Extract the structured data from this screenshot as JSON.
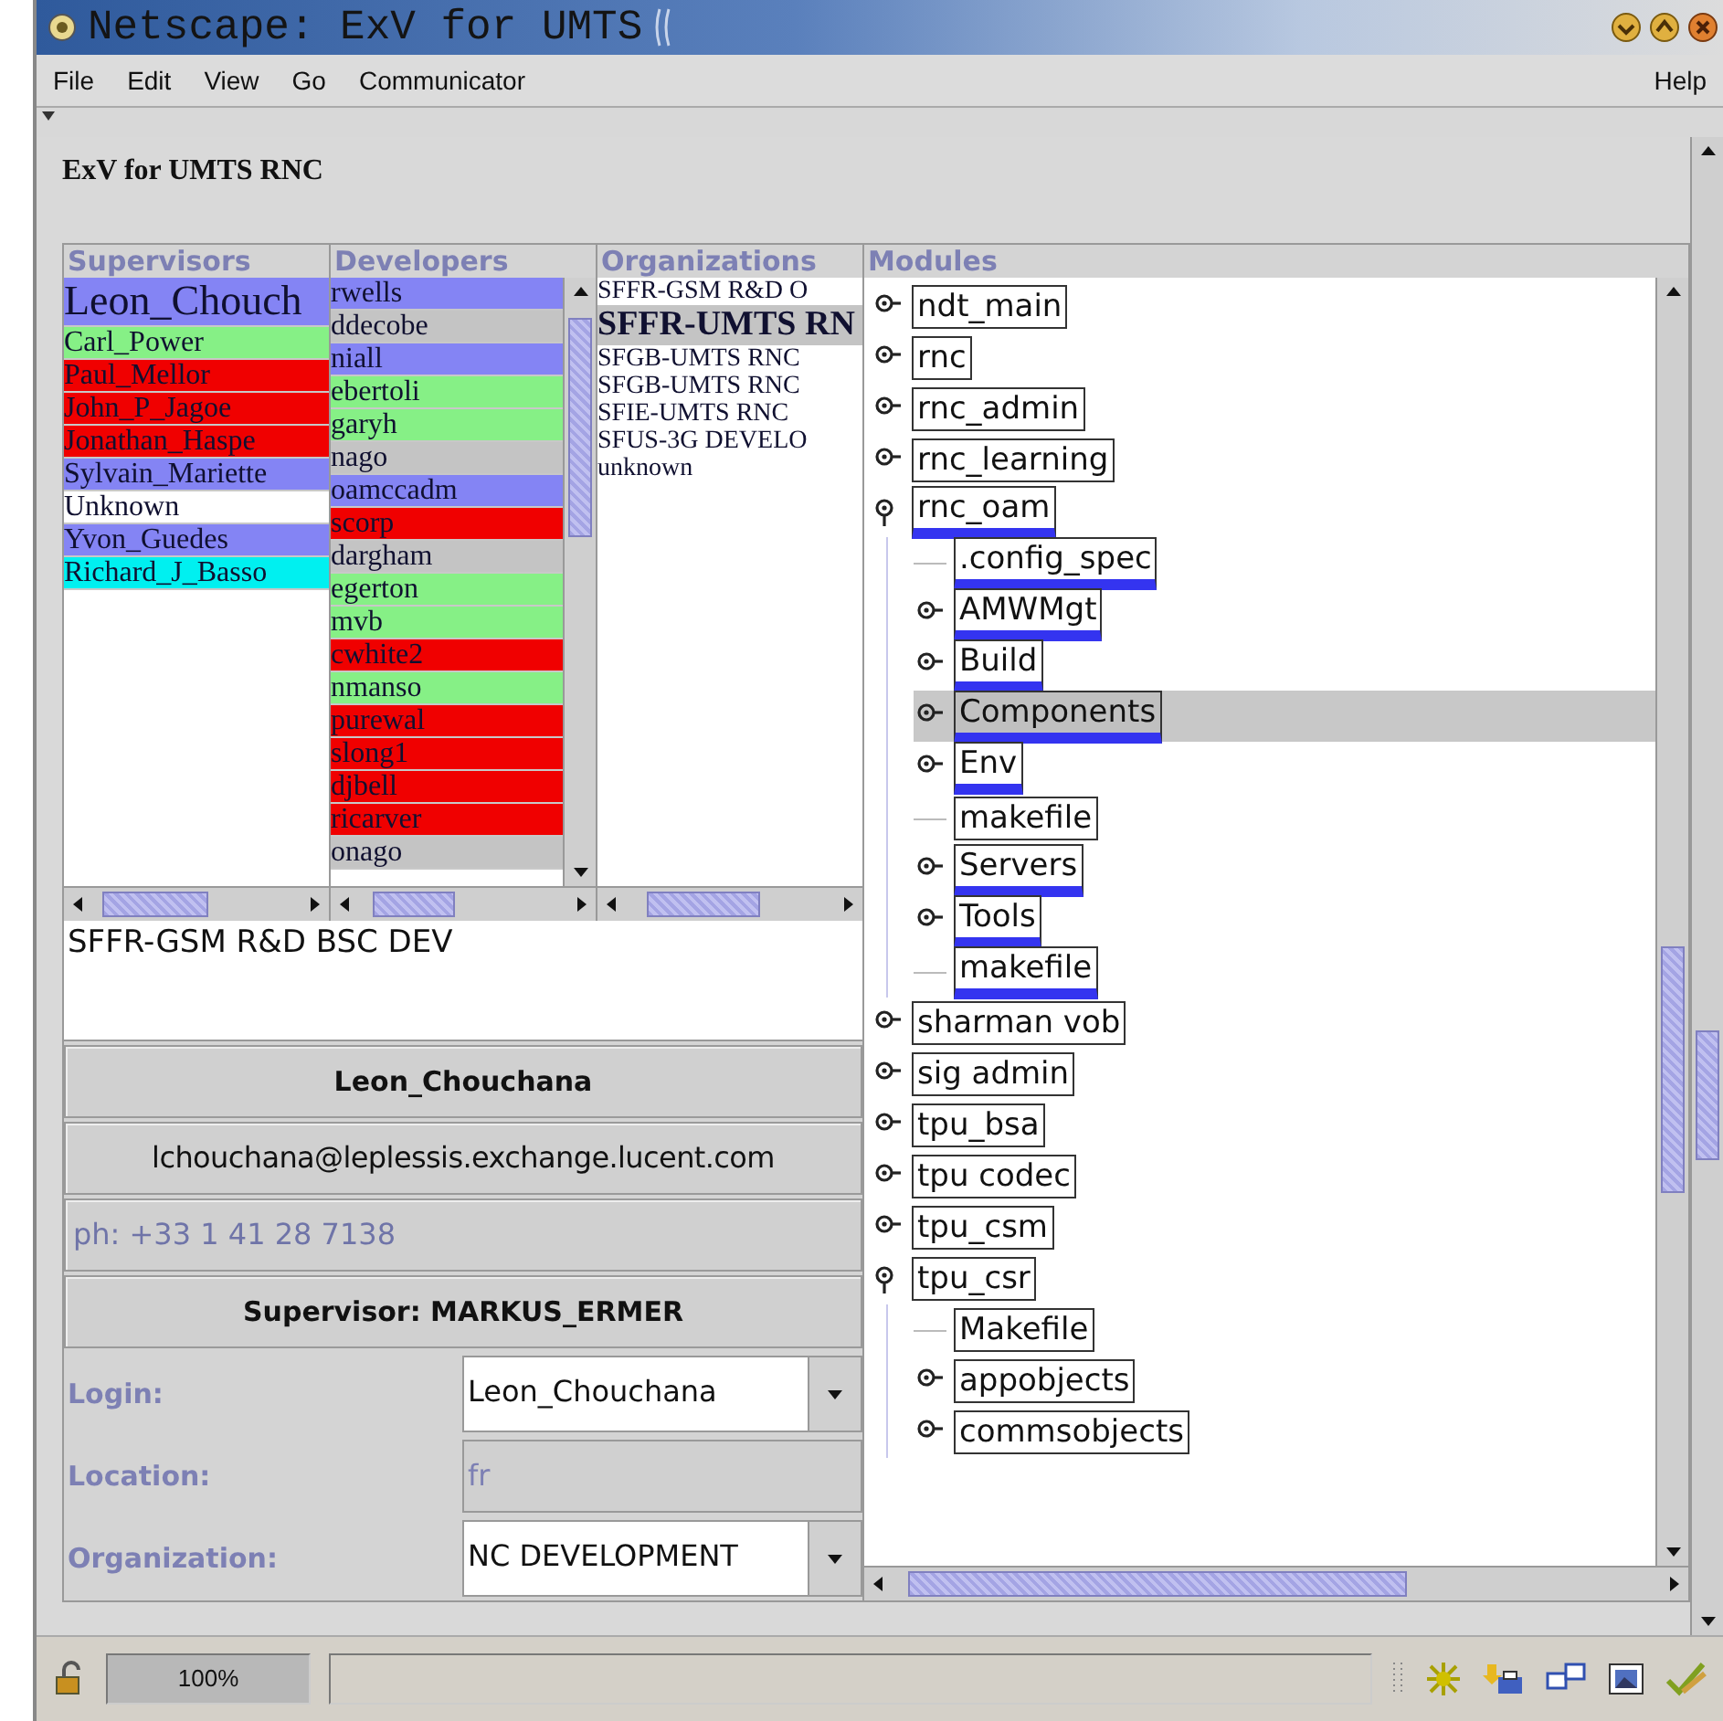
{
  "window": {
    "title": "Netscape: ExV for UMTS"
  },
  "menu": [
    {
      "label": "File"
    },
    {
      "label": "Edit"
    },
    {
      "label": "View"
    },
    {
      "label": "Go"
    },
    {
      "label": "Communicator"
    }
  ],
  "help_menu": {
    "label": "Help"
  },
  "page_title": "ExV for UMTS RNC",
  "supervisors": {
    "header": "Supervisors",
    "items": [
      {
        "name": "Leon_Chouch",
        "color": "#8484f4",
        "selected": true
      },
      {
        "name": "Carl_Power",
        "color": "#86f086",
        "selected": false
      },
      {
        "name": "Paul_Mellor",
        "color": "#f00000",
        "selected": false
      },
      {
        "name": "John_P_Jagoe",
        "color": "#f00000",
        "selected": false
      },
      {
        "name": "Jonathan_Haspe",
        "color": "#f00000",
        "selected": false
      },
      {
        "name": "Sylvain_Mariette",
        "color": "#8484f4",
        "selected": false
      },
      {
        "name": "Unknown",
        "color": "#ffffff",
        "selected": false
      },
      {
        "name": "Yvon_Guedes",
        "color": "#8484f4",
        "selected": false
      },
      {
        "name": "Richard_J_Basso",
        "color": "#00f0f0",
        "selected": false
      }
    ]
  },
  "developers": {
    "header": "Developers",
    "items": [
      {
        "name": "rwells",
        "color": "#8484f4"
      },
      {
        "name": "ddecobe",
        "color": "#c4c4c4"
      },
      {
        "name": "niall",
        "color": "#8484f4"
      },
      {
        "name": "ebertoli",
        "color": "#86f086"
      },
      {
        "name": "garyh",
        "color": "#86f086"
      },
      {
        "name": "nago",
        "color": "#c4c4c4"
      },
      {
        "name": "oamccadm",
        "color": "#8484f4"
      },
      {
        "name": "scorp",
        "color": "#f00000"
      },
      {
        "name": "dargham",
        "color": "#c4c4c4"
      },
      {
        "name": "egerton",
        "color": "#86f086"
      },
      {
        "name": "mvb",
        "color": "#86f086"
      },
      {
        "name": "cwhite2",
        "color": "#f00000"
      },
      {
        "name": "nmanso",
        "color": "#86f086"
      },
      {
        "name": "purewal",
        "color": "#f00000"
      },
      {
        "name": "slong1",
        "color": "#f00000"
      },
      {
        "name": "djbell",
        "color": "#f00000"
      },
      {
        "name": "ricarver",
        "color": "#f00000"
      },
      {
        "name": "onago",
        "color": "#c4c4c4"
      }
    ]
  },
  "organizations": {
    "header": "Organizations",
    "items": [
      {
        "name": "SFFR-GSM R&D O",
        "selected": false
      },
      {
        "name": "SFFR-UMTS RN",
        "selected": true
      },
      {
        "name": "SFGB-UMTS RNC",
        "selected": false
      },
      {
        "name": "SFGB-UMTS RNC",
        "selected": false
      },
      {
        "name": "SFIE-UMTS RNC",
        "selected": false
      },
      {
        "name": "SFUS-3G DEVELO",
        "selected": false
      },
      {
        "name": "unknown",
        "selected": false
      }
    ]
  },
  "modules": {
    "header": "Modules",
    "tree": [
      {
        "label": "ndt_main",
        "kind": "folder",
        "expanded": false,
        "marked": false,
        "selected": false
      },
      {
        "label": "rnc",
        "kind": "folder",
        "expanded": false,
        "marked": false,
        "selected": false
      },
      {
        "label": "rnc_admin",
        "kind": "folder",
        "expanded": false,
        "marked": false,
        "selected": false
      },
      {
        "label": "rnc_learning",
        "kind": "folder",
        "expanded": false,
        "marked": false,
        "selected": false
      },
      {
        "label": "rnc_oam",
        "kind": "folder",
        "expanded": true,
        "marked": true,
        "selected": false,
        "children": [
          {
            "label": ".config_spec",
            "kind": "leaf",
            "marked": true,
            "selected": false
          },
          {
            "label": "AMWMgt",
            "kind": "folder",
            "expanded": false,
            "marked": true,
            "selected": false
          },
          {
            "label": "Build",
            "kind": "folder",
            "expanded": false,
            "marked": true,
            "selected": false
          },
          {
            "label": "Components",
            "kind": "folder",
            "expanded": false,
            "marked": true,
            "selected": true
          },
          {
            "label": "Env",
            "kind": "folder",
            "expanded": false,
            "marked": true,
            "selected": false
          },
          {
            "label": "makefile",
            "kind": "leaf",
            "marked": false,
            "selected": false
          },
          {
            "label": "Servers",
            "kind": "folder",
            "expanded": false,
            "marked": true,
            "selected": false
          },
          {
            "label": "Tools",
            "kind": "folder",
            "expanded": false,
            "marked": true,
            "selected": false
          },
          {
            "label": "makefile",
            "kind": "leaf",
            "marked": true,
            "selected": false
          }
        ]
      },
      {
        "label": "sharman vob",
        "kind": "folder",
        "expanded": false,
        "marked": false,
        "selected": false
      },
      {
        "label": "sig admin",
        "kind": "folder",
        "expanded": false,
        "marked": false,
        "selected": false
      },
      {
        "label": "tpu_bsa",
        "kind": "folder",
        "expanded": false,
        "marked": false,
        "selected": false
      },
      {
        "label": "tpu codec",
        "kind": "folder",
        "expanded": false,
        "marked": false,
        "selected": false
      },
      {
        "label": "tpu_csm",
        "kind": "folder",
        "expanded": false,
        "marked": false,
        "selected": false
      },
      {
        "label": "tpu_csr",
        "kind": "folder",
        "expanded": true,
        "marked": false,
        "selected": false,
        "children": [
          {
            "label": "Makefile",
            "kind": "leaf",
            "marked": false,
            "selected": false
          },
          {
            "label": "appobjects",
            "kind": "folder",
            "expanded": false,
            "marked": false,
            "selected": false
          },
          {
            "label": "commsobjects",
            "kind": "folder",
            "expanded": false,
            "marked": false,
            "selected": false
          }
        ]
      }
    ]
  },
  "details": {
    "organization": "SFFR-GSM R&D BSC DEV",
    "name": "Leon_Chouchana",
    "email": "lchouchana@leplessis.exchange.lucent.com",
    "phone": "ph: +33 1 41 28 7138",
    "supervisor": "Supervisor: MARKUS_ERMER",
    "fields": [
      {
        "label": "Login:",
        "value": "Leon_Chouchana",
        "kind": "combo",
        "disabled": false
      },
      {
        "label": "Location:",
        "value": "fr",
        "kind": "text",
        "disabled": true
      },
      {
        "label": "Organization:",
        "value": "NC DEVELOPMENT",
        "kind": "combo",
        "disabled": false
      }
    ]
  },
  "status_bar": {
    "zoom": "100%"
  }
}
